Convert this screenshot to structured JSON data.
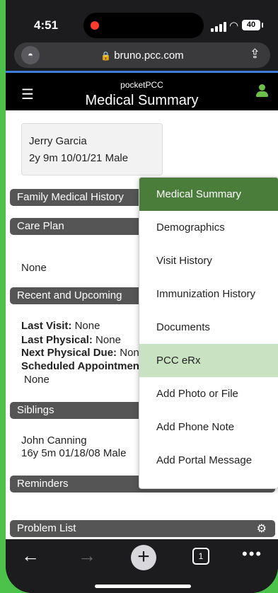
{
  "status_bar": {
    "time": "4:51",
    "battery": "40"
  },
  "browser": {
    "url": "bruno.pcc.com",
    "tab_count": "1"
  },
  "app": {
    "brand": "pocketPCC",
    "title": "Medical Summary"
  },
  "patient": {
    "name": "Jerry Garcia",
    "info": "2y 9m  10/01/21  Male"
  },
  "sections": {
    "family_history": "Family Medical History",
    "care_plan": "Care Plan",
    "care_plan_value": "None",
    "recent": "Recent and Upcoming",
    "last_visit_label": "Last Visit:",
    "last_visit_value": " None",
    "last_physical_label": "Last Physical:",
    "last_physical_value": " None",
    "next_physical_label": "Next Physical Due:",
    "next_physical_value": " None",
    "scheduled_label": "Scheduled Appointments:",
    "scheduled_value": "None",
    "siblings": "Siblings",
    "sibling_name": "John Canning",
    "sibling_info": "16y 5m  01/18/08  Male",
    "reminders": "Reminders",
    "problem_list": "Problem List"
  },
  "menu": {
    "items": [
      "Medical Summary",
      "Demographics",
      "Visit History",
      "Immunization History",
      "Documents",
      "PCC eRx",
      "Add Photo or File",
      "Add Phone Note",
      "Add Portal Message"
    ]
  }
}
